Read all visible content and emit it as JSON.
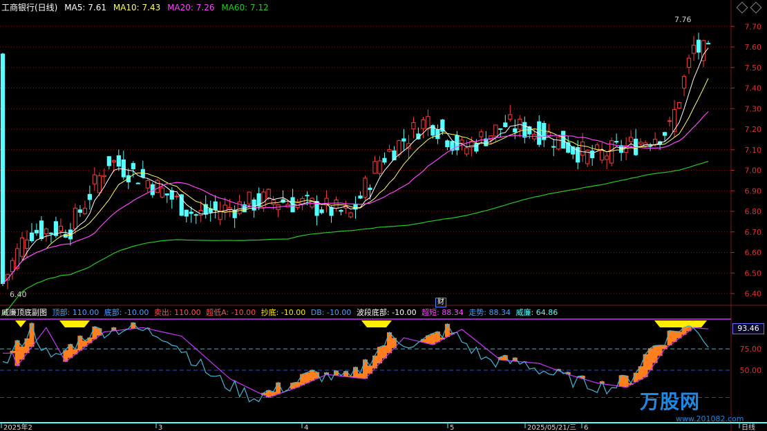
{
  "header": {
    "title": "工商银行(日线)",
    "ma5": "MA5: 7.61",
    "ma10": "MA10: 7.43",
    "ma20": "MA20: 7.26",
    "ma60": "MA60: 7.12"
  },
  "price_labels": {
    "high": "7.76",
    "low": "6.40"
  },
  "y_ticks": [
    "7.70",
    "7.60",
    "7.50",
    "7.40",
    "7.30",
    "7.20",
    "7.10",
    "7.00",
    "6.90",
    "6.80",
    "6.70",
    "6.60",
    "6.50",
    "6.40"
  ],
  "event_marker": "财",
  "indicator_header": {
    "name": "威廉顶底副图",
    "top": "顶部: 110.00",
    "bottom": "底部: -10.00",
    "sell": "卖出: 110.00",
    "super_low": "超低A: -10.00",
    "buy_bottom": "抄底: -10.00",
    "db": "DB: -10.00",
    "wave_bottom": "波段底部: -10.00",
    "super_short": "超短: 88.34",
    "trend": "走势: 88.34",
    "williams": "威廉: 64.86"
  },
  "indicator_ticks": [
    "75.00",
    "50.00"
  ],
  "indicator_current": "93.46",
  "x_labels": [
    "2025年2",
    "3",
    "4",
    "5",
    "2025/05/21/三",
    "6",
    "日线"
  ],
  "logo": {
    "brand": "万股网",
    "url": "www.201082.com"
  },
  "colors": {
    "up": "#ff3b3b",
    "down": "#55ffff",
    "ma5": "#ffffff",
    "ma10": "#ffff66",
    "ma20": "#ff44ff",
    "ma60": "#22cc22",
    "grid": "#8b1a1a",
    "orange": "#ff7f1e",
    "yellow": "#ffee00",
    "magenta": "#cc33ff"
  }
}
